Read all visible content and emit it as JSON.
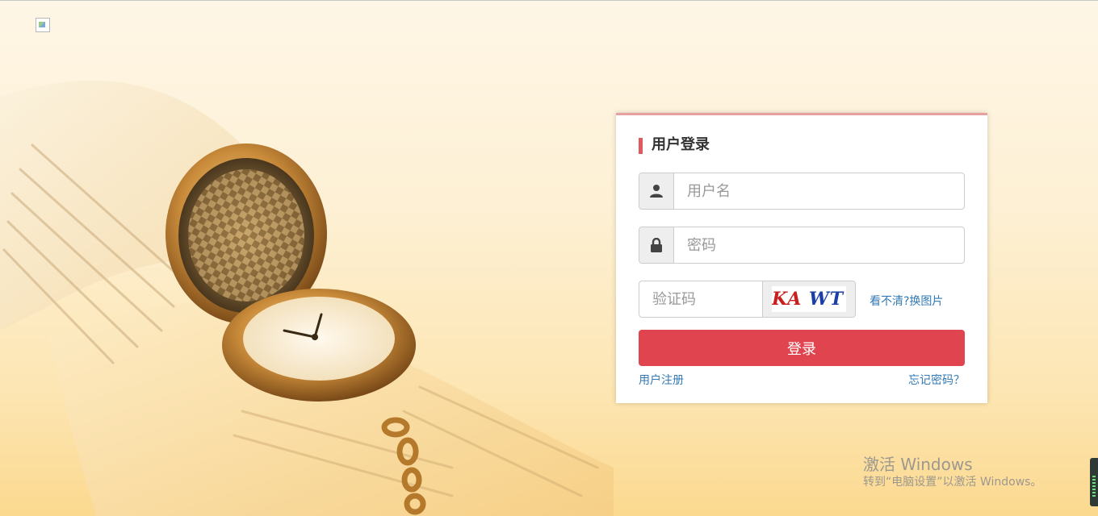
{
  "login": {
    "title": "用户登录",
    "username_placeholder": "用户名",
    "password_placeholder": "密码",
    "captcha_placeholder": "验证码",
    "captcha_text_a": "KA",
    "captcha_text_b": "WT",
    "refresh_label": "看不清?换图片",
    "submit_label": "登录",
    "register_label": "用户注册",
    "forgot_label": "忘记密码？"
  },
  "activation": {
    "title": "激活 Windows",
    "subtitle": "转到“电脑设置”以激活 Windows。"
  },
  "colors": {
    "accent": "#e0454f",
    "link": "#337ab7",
    "title_bar": "#e0595f"
  },
  "icons": [
    "user-icon",
    "lock-icon",
    "broken-image-icon"
  ]
}
